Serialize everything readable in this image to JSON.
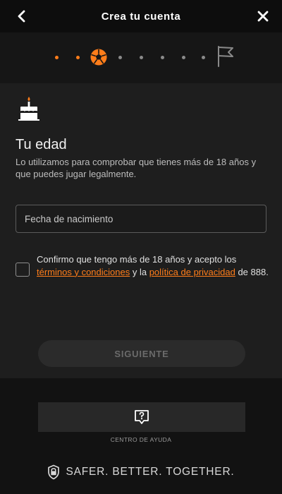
{
  "header": {
    "title": "Crea tu cuenta",
    "back_icon": "chevron-left-icon",
    "close_icon": "close-icon"
  },
  "progress": {
    "total_steps": 8,
    "current_step": 3,
    "current_icon": "soccer-ball-icon",
    "final_icon": "flag-icon",
    "accent_color": "#ff7d1a"
  },
  "age_section": {
    "icon": "birthday-cake-icon",
    "heading": "Tu edad",
    "description": "Lo utilizamos para comprobar que tienes más de 18 años y que puedes jugar legalmente.",
    "birthdate_placeholder": "Fecha de nacimiento"
  },
  "consent": {
    "checked": false,
    "text_before": "Confirmo que tengo más de 18 años y acepto los ",
    "terms_link": "términos y condiciones",
    "text_middle": " y la ",
    "privacy_link": "política de privacidad",
    "text_after": " de 888."
  },
  "actions": {
    "next_label": "SIGUIENTE"
  },
  "footer": {
    "help_icon": "help-chat-icon",
    "help_label": "CENTRO DE AYUDA",
    "shield_icon": "shield-icon",
    "tagline": "SAFER. BETTER. TOGETHER."
  }
}
